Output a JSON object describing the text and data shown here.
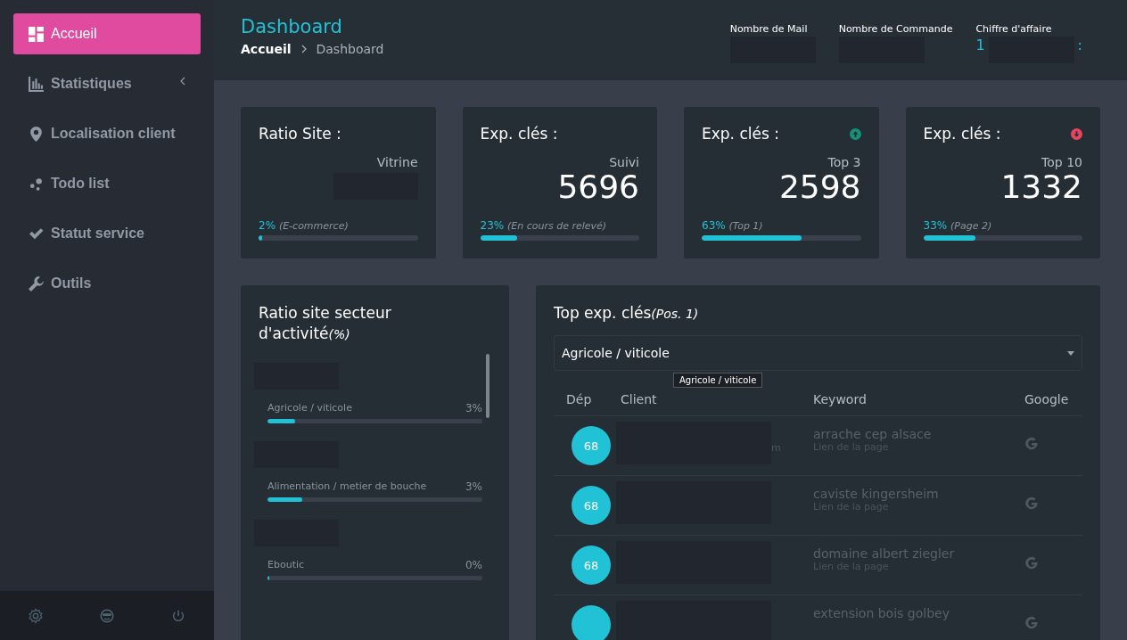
{
  "sidebar": {
    "items": [
      {
        "label": "Accueil",
        "selected": true
      },
      {
        "label": "Statistiques",
        "selected": false,
        "expanded": false
      },
      {
        "label": "Localisation client",
        "selected": false
      },
      {
        "label": "Todo list",
        "selected": false
      },
      {
        "label": "Statut service",
        "selected": false
      },
      {
        "label": "Outils",
        "selected": false
      }
    ]
  },
  "header": {
    "title": "Dashboard",
    "breadcrumb": [
      "Accueil",
      "Dashboard"
    ],
    "stats": [
      {
        "label": "Nombre de Mail"
      },
      {
        "label": "Nombre de Commande"
      },
      {
        "label": "Chiffre d'affaire",
        "value_start": "1",
        "value_end": ":"
      }
    ]
  },
  "cards": [
    {
      "title": "Ratio Site :",
      "subtitle": "Vitrine",
      "percent": "2%",
      "note": "(E-commerce)",
      "level": 0.02
    },
    {
      "title": "Exp. clés :",
      "subtitle": "Suivi",
      "value": "5696",
      "percent": "23%",
      "note": "(En cours de relevé)",
      "level": 0.23
    },
    {
      "title": "Exp. clés :",
      "subtitle": "Top 3",
      "value": "2598",
      "percent": "63%",
      "note": "(Top 1)",
      "level": 0.63,
      "kind": "up"
    },
    {
      "title": "Exp. clés :",
      "subtitle": "Top 10",
      "value": "1332",
      "percent": "33%",
      "note": "(Page 2)",
      "level": 0.33,
      "kind": "down"
    }
  ],
  "sector_card": {
    "title": "Ratio site secteur d'activité",
    "title_note": "(%)",
    "sectors": [
      {
        "name": "Agricole / viticole",
        "reading": "3%",
        "level": 0.13
      },
      {
        "name": "Alimentation / metier de bouche",
        "reading": "3%",
        "level": 0.16
      },
      {
        "name": "Eboutic",
        "reading": "0%",
        "level": 0.01
      }
    ]
  },
  "keywords_card": {
    "title": "Top exp. clés",
    "title_note": "(Pos. 1)",
    "select": {
      "value": "Agricole / viticole"
    },
    "tooltip": "Agricole / viticole",
    "columns": [
      "Dép",
      "Client",
      "Keyword",
      "Google"
    ],
    "rows": [
      {
        "dep": "68",
        "client": "m",
        "keyword": "arrache cep alsace",
        "link": "Lien de la page"
      },
      {
        "dep": "68",
        "keyword": "caviste kingersheim",
        "link": "Lien de la page"
      },
      {
        "dep": "68",
        "keyword": "domaine albert ziegler",
        "link": "Lien de la page"
      },
      {
        "keyword": "extension bois golbey"
      }
    ]
  }
}
